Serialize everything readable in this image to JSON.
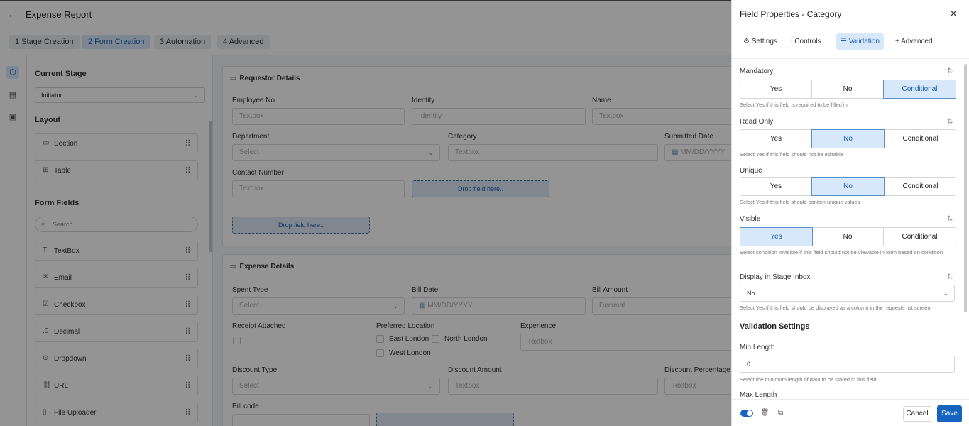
{
  "app": {
    "title": "Expense Report"
  },
  "steps": [
    "1 Stage Creation",
    "2 Form Creation",
    "3 Automation",
    "4 Advanced"
  ],
  "left": {
    "current_stage_label": "Current Stage",
    "current_stage_value": "Initiator",
    "layout_label": "Layout",
    "layout_items": [
      "Section",
      "Table"
    ],
    "form_fields_label": "Form Fields",
    "search_placeholder": "Search",
    "fields": [
      "TextBox",
      "Email",
      "Checkbox",
      "Decimal",
      "Dropdown",
      "URL",
      "File Uploader"
    ]
  },
  "canvas": {
    "requestor": {
      "title": "Requestor Details",
      "employee_no_label": "Employee No",
      "employee_no_ph": "Textbox",
      "identity_label": "Identity",
      "identity_ph": "Identity",
      "name_label": "Name",
      "name_ph": "Textbox",
      "department_label": "Department",
      "department_ph": "Select",
      "category_label": "Category",
      "category_ph": "Textbox",
      "submitted_label": "Submitted Date",
      "submitted_ph": "MM/DD/YYYY",
      "contact_label": "Contact Number",
      "contact_ph": "Textbox",
      "drop_1": "Drop field here..",
      "drop_2": "Drop field here.."
    },
    "expense": {
      "title": "Expense Details",
      "spent_type_label": "Spent Type",
      "spent_type_ph": "Select",
      "bill_date_label": "Bill Date",
      "bill_date_ph": "MM/DD/YYYY",
      "bill_amount_label": "Bill Amount",
      "bill_amount_ph": "Decimal",
      "receipt_label": "Receipt Attached",
      "pref_loc_label": "Preferred Location",
      "loc_options": [
        "East London",
        "North London",
        "West London"
      ],
      "experience_label": "Experience",
      "experience_ph": "Textbox",
      "discount_type_label": "Discount Type",
      "discount_type_ph": "Select",
      "discount_amount_label": "Discount Amount",
      "discount_amount_ph": "Textbox",
      "discount_pct_label": "Discount Percentage",
      "discount_pct_ph": "Textbox",
      "bill_code_label": "Bill code"
    }
  },
  "panel": {
    "title": "Field Properties - Category",
    "tabs": [
      "Settings",
      "Controls",
      "Validation",
      "Advanced"
    ],
    "options": [
      "Yes",
      "No",
      "Conditional"
    ],
    "mandatory": {
      "label": "Mandatory",
      "hint": "Select Yes if this field is required to be filled in"
    },
    "read_only": {
      "label": "Read Only",
      "hint": "Select Yes if this field should not be editable"
    },
    "unique": {
      "label": "Unique",
      "hint": "Select Yes if this field should contain unique values"
    },
    "visible": {
      "label": "Visible",
      "hint": "Select condition Invisible if this field should not be viewable in form based on condition"
    },
    "display_inbox": {
      "label": "Display in Stage Inbox",
      "value": "No",
      "hint": "Select Yes if this field should be displayed as a column in the requests list screen"
    },
    "validation_settings": "Validation Settings",
    "min_length": {
      "label": "Min Length",
      "value": "0",
      "hint": "Select the minimum length of data to be stored in this field"
    },
    "max_length_label": "Max Length",
    "cancel": "Cancel",
    "save": "Save"
  }
}
